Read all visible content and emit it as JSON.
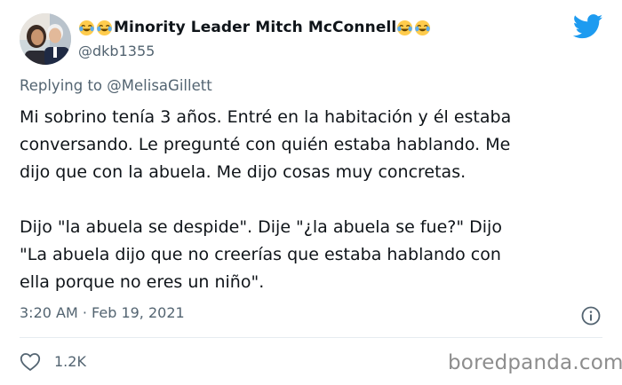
{
  "author": {
    "display_name": "Minority Leader Mitch McConnell",
    "handle": "@dkb1355",
    "emoji_prefix": "joy-emoji",
    "emoji_suffix": "joy-emoji"
  },
  "reply_context": {
    "prefix": "Replying to ",
    "mention": "@MelisaGillett"
  },
  "tweet": {
    "text": "Mi sobrino tenía 3 años. Entré en la habitación y él estaba\nconversando. Le pregunté con quién estaba hablando. Me\ndijo que con la abuela. Me dijo cosas muy concretas.\n\nDijo \"la abuela se despide\". Dije \"¿la abuela se fue?\" Dijo\n\"La abuela dijo que no creerías que estaba hablando con\nella porque no eres un niño\".",
    "timestamp": "3:20 AM · Feb 19, 2021"
  },
  "engagement": {
    "like_count": "1.2K"
  },
  "watermark": "boredpanda.com",
  "colors": {
    "twitter_blue": "#1d9bf0",
    "secondary_text": "#536471",
    "primary_text": "#0f1419"
  }
}
